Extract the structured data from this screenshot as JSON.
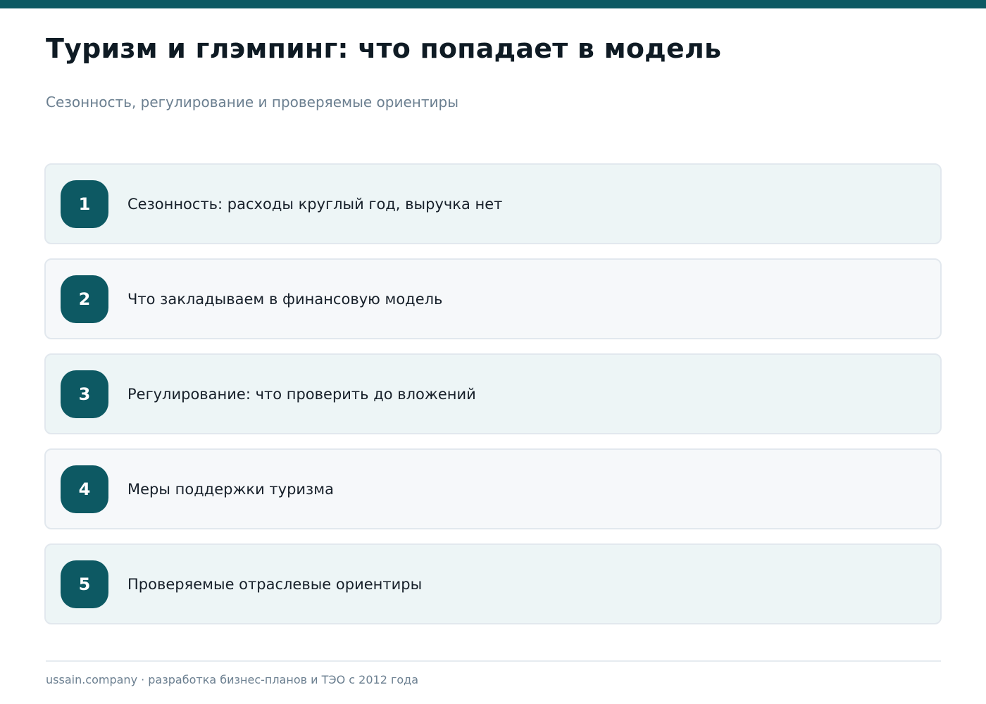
{
  "title": "Туризм и глэмпинг: что попадает в модель",
  "subtitle": "Сезонность, регулирование и проверяемые ориентиры",
  "items": [
    {
      "number": "1",
      "text": "Сезонность: расходы круглый год, выручка нет"
    },
    {
      "number": "2",
      "text": "Что закладываем в финансовую модель"
    },
    {
      "number": "3",
      "text": "Регулирование: что проверить до вложений"
    },
    {
      "number": "4",
      "text": "Меры поддержки туризма"
    },
    {
      "number": "5",
      "text": "Проверяемые отраслевые ориентиры"
    }
  ],
  "footer": "ussain.company · разработка бизнес-планов и ТЭО с 2012 года",
  "colors": {
    "accent": "#0d5963",
    "card_alt": "#edf5f6",
    "card": "#f6f8fa",
    "muted_text": "#6b7f90"
  }
}
